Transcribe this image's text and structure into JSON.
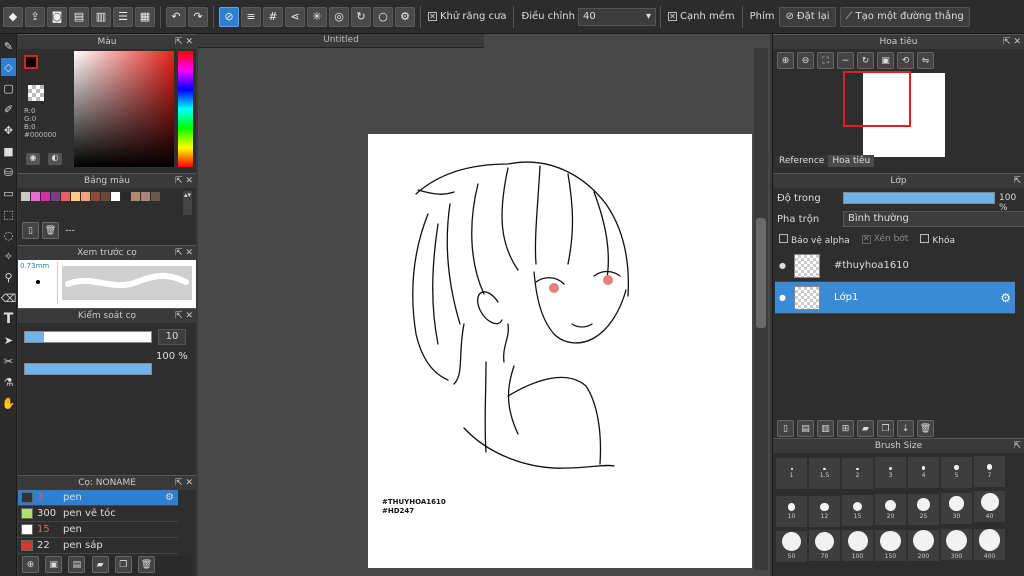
{
  "toolbar": {
    "antialias_label": "Khử răng cưa",
    "adjust_label": "Điều chỉnh",
    "adjust_value": "40",
    "soft_edge_label": "Cạnh mềm",
    "key_label": "Phím",
    "reset_label": "Đặt lại",
    "straight_line_label": "Tạo một đường thẳng"
  },
  "canvas": {
    "tab_title": "Untitled",
    "watermark_line1": "#THUYHOA1610",
    "watermark_line2": "#HD247"
  },
  "color_panel": {
    "title": "Màu",
    "r": "R:0",
    "g": "G:0",
    "b": "B:0",
    "hex": "#000000"
  },
  "palette_panel": {
    "title": "Bảng màu",
    "colors": [
      "#c8c8c8",
      "#e86dd6",
      "#d22fa6",
      "#7f3e7c",
      "#ef5f5f",
      "#ffcc88",
      "#f4a07a",
      "#8e4b3a",
      "#6b4a3a",
      "#ffffff",
      "#2a2a2a",
      "#b08a6e",
      "#a8877a",
      "#6a5a4e"
    ],
    "value": "---"
  },
  "brush_preview_panel": {
    "title": "Xem trước cọ",
    "size_label": "0.73mm"
  },
  "brush_control_panel": {
    "title": "Kiểm soát cọ",
    "size_value": "10",
    "size_fraction": 0.15,
    "opacity_value": "100 %",
    "opacity_fraction": 1.0
  },
  "brush_list_panel": {
    "title": "Cọ: NONAME",
    "brushes": [
      {
        "color": "#333333",
        "size": "3",
        "name": "pen",
        "selected": true
      },
      {
        "color": "#b3e06f",
        "size": "300",
        "name": "pen vẽ tóc",
        "selected": false
      },
      {
        "color": "#ffffff",
        "size": "15",
        "name": "pen",
        "selected": false
      },
      {
        "color": "#e03030",
        "size": "22",
        "name": "pen sáp",
        "selected": false
      }
    ]
  },
  "navigator_panel": {
    "title": "Hoa tiêu",
    "tabs": [
      "Reference",
      "Hoa tiêu"
    ]
  },
  "layer_panel": {
    "title": "Lớp",
    "opacity_label": "Độ trong",
    "opacity_value": "100 %",
    "opacity_fraction": 1.0,
    "blend_label": "Pha trộn",
    "blend_value": "Bình thường",
    "protect_alpha": "Bảo vệ alpha",
    "clipping": "Xén bớt",
    "lock": "Khóa",
    "layers": [
      {
        "name": "#thuyhoa1610",
        "selected": false
      },
      {
        "name": "Lớp1",
        "selected": true
      }
    ]
  },
  "brush_size_panel": {
    "title": "Brush Size",
    "row1": [
      "1",
      "1.5",
      "2",
      "3",
      "4",
      "5",
      "7"
    ],
    "row2": [
      "10",
      "12",
      "15",
      "20",
      "25",
      "30",
      "40"
    ],
    "row3": [
      "50",
      "70",
      "100",
      "150",
      "200",
      "300",
      "400"
    ]
  }
}
